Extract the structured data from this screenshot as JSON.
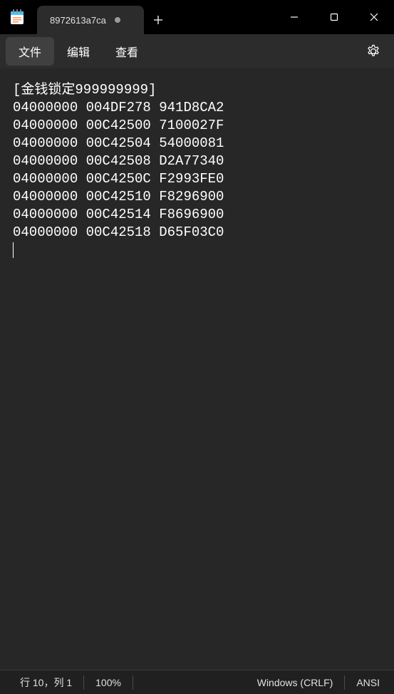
{
  "tab": {
    "title": "8972613a7ca",
    "modified": true
  },
  "menu": {
    "file": "文件",
    "edit": "编辑",
    "view": "查看"
  },
  "editor": {
    "lines": [
      "[金钱锁定999999999]",
      "04000000 004DF278 941D8CA2",
      "04000000 00C42500 7100027F",
      "04000000 00C42504 54000081",
      "04000000 00C42508 D2A77340",
      "04000000 00C4250C F2993FE0",
      "04000000 00C42510 F8296900",
      "04000000 00C42514 F8696900",
      "04000000 00C42518 D65F03C0"
    ]
  },
  "status": {
    "position": "行 10，列 1",
    "zoom": "100%",
    "line_ending": "Windows (CRLF)",
    "encoding": "ANSI"
  }
}
